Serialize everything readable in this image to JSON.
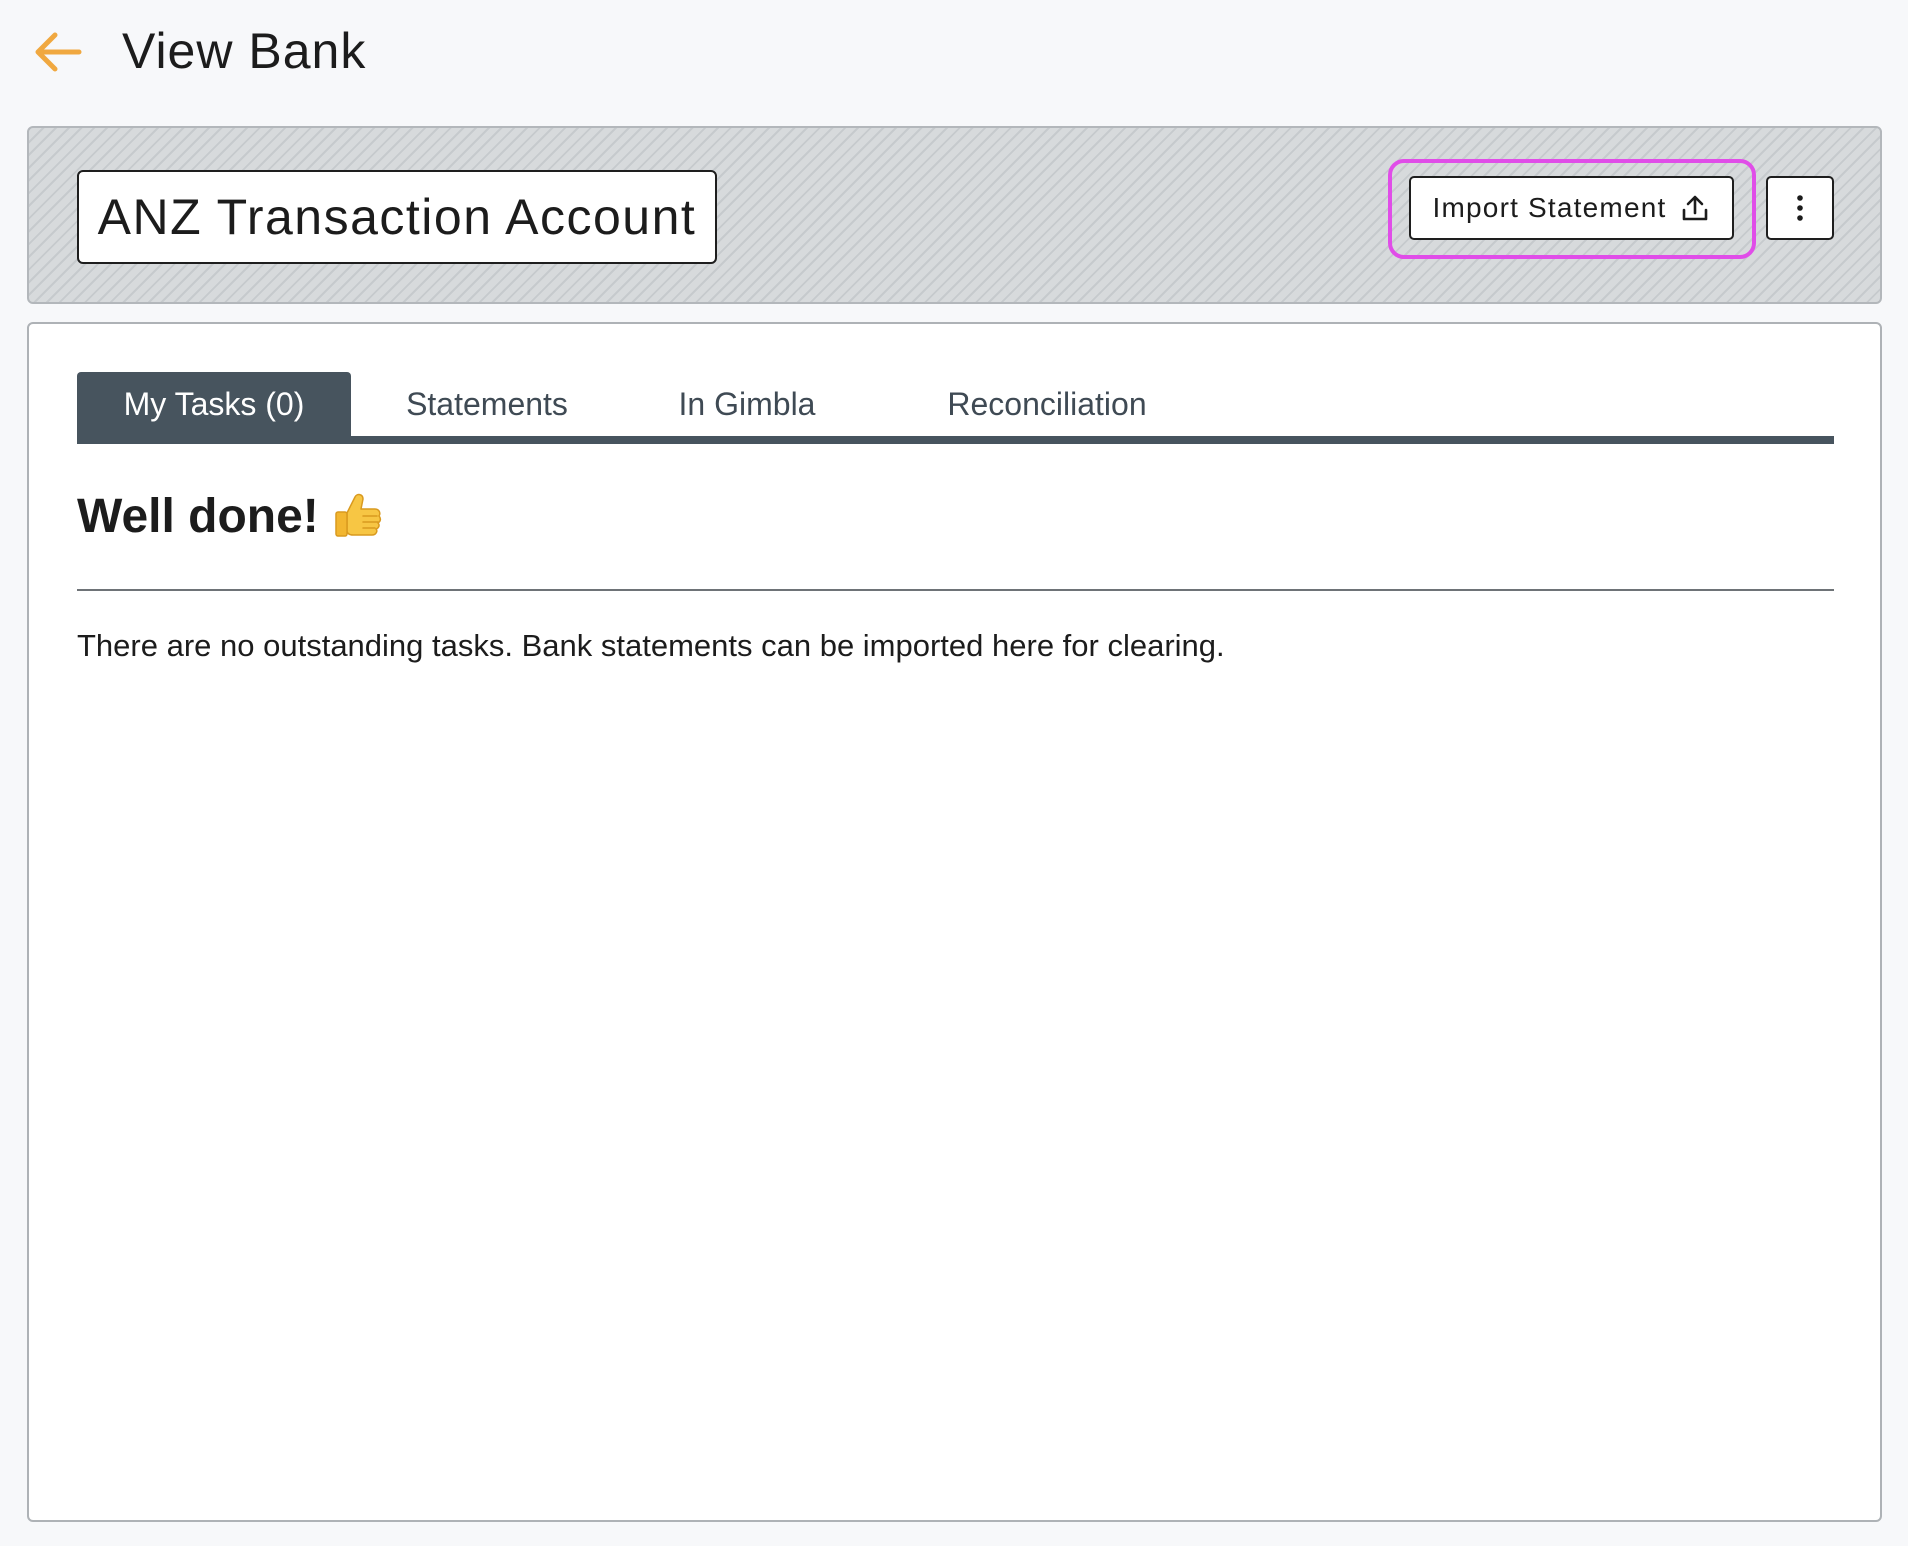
{
  "header": {
    "title": "View Bank",
    "back_icon": "arrow-left-icon",
    "accent_color": "#f0a840"
  },
  "account": {
    "name": "ANZ Transaction Account"
  },
  "actions": {
    "import_label": "Import Statement",
    "import_icon": "upload-icon",
    "more_icon": "more-vertical-icon",
    "highlight_color": "#e04de8"
  },
  "tabs": [
    {
      "label": "My Tasks (0)",
      "active": true
    },
    {
      "label": "Statements",
      "active": false
    },
    {
      "label": "In Gimbla",
      "active": false
    },
    {
      "label": "Reconciliation",
      "active": false
    }
  ],
  "content": {
    "heading": "Well done!",
    "heading_icon": "thumbs-up-icon",
    "message": "There are no outstanding tasks. Bank statements can be imported here for clearing."
  },
  "colors": {
    "tab_active_bg": "#47545e",
    "page_bg": "#f7f8fa"
  }
}
